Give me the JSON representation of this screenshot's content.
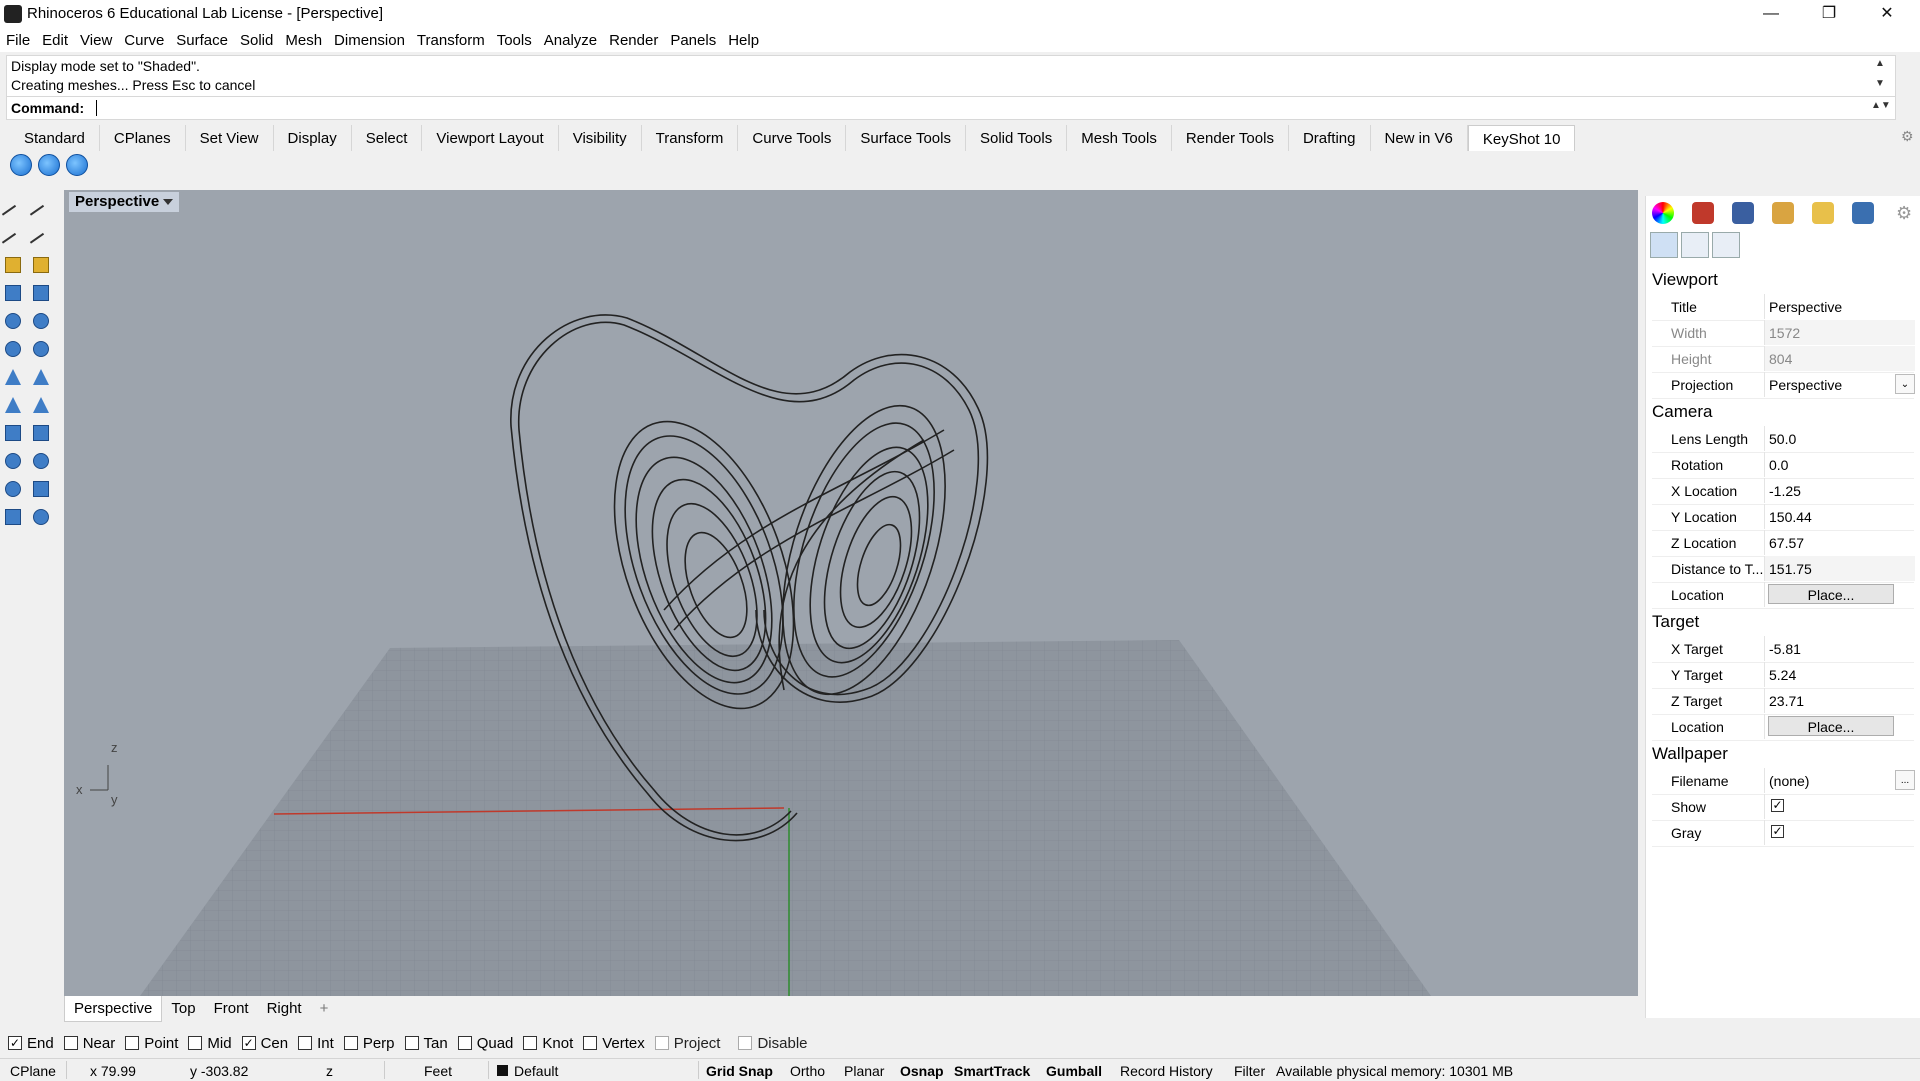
{
  "window": {
    "title": "Rhinoceros 6 Educational Lab License - [Perspective]"
  },
  "menu": [
    "File",
    "Edit",
    "View",
    "Curve",
    "Surface",
    "Solid",
    "Mesh",
    "Dimension",
    "Transform",
    "Tools",
    "Analyze",
    "Render",
    "Panels",
    "Help"
  ],
  "command": {
    "history": [
      "Display mode set to \"Shaded\".",
      "Creating meshes... Press Esc to cancel"
    ],
    "prompt_label": "Command:"
  },
  "toolbar_tabs": [
    "Standard",
    "CPlanes",
    "Set View",
    "Display",
    "Select",
    "Viewport Layout",
    "Visibility",
    "Transform",
    "Curve Tools",
    "Surface Tools",
    "Solid Tools",
    "Mesh Tools",
    "Render Tools",
    "Drafting",
    "New in V6",
    "KeyShot 10"
  ],
  "toolbar_tabs_active": "KeyShot 10",
  "keyshot_icons": [
    "keyshot-render-icon",
    "keyshot-update-icon",
    "keyshot-link-icon"
  ],
  "viewport": {
    "title": "Perspective",
    "axis_labels": {
      "z": "z",
      "x": "x",
      "y": "y"
    }
  },
  "viewport_tabs": [
    "Perspective",
    "Top",
    "Front",
    "Right"
  ],
  "viewport_tabs_add": "+",
  "panel": {
    "sections": {
      "viewport": "Viewport",
      "camera": "Camera",
      "target": "Target",
      "wallpaper": "Wallpaper"
    },
    "viewport_props": [
      {
        "label": "Title",
        "value": "Perspective"
      },
      {
        "label": "Width",
        "value": "1572"
      },
      {
        "label": "Height",
        "value": "804"
      },
      {
        "label": "Projection",
        "value": "Perspective"
      }
    ],
    "camera_props": [
      {
        "label": "Lens Length",
        "value": "50.0"
      },
      {
        "label": "Rotation",
        "value": "0.0"
      },
      {
        "label": "X Location",
        "value": "-1.25"
      },
      {
        "label": "Y Location",
        "value": "150.44"
      },
      {
        "label": "Z Location",
        "value": "67.57"
      },
      {
        "label": "Distance to T...",
        "value": "151.75"
      },
      {
        "label": "Location",
        "value": "Place..."
      }
    ],
    "target_props": [
      {
        "label": "X Target",
        "value": "-5.81"
      },
      {
        "label": "Y Target",
        "value": "5.24"
      },
      {
        "label": "Z Target",
        "value": "23.71"
      },
      {
        "label": "Location",
        "value": "Place..."
      }
    ],
    "wallpaper_props": [
      {
        "label": "Filename",
        "value": "(none)",
        "button": "..."
      },
      {
        "label": "Show",
        "checked": true
      },
      {
        "label": "Gray",
        "checked": true
      }
    ]
  },
  "osnaps": [
    {
      "label": "End",
      "checked": true
    },
    {
      "label": "Near",
      "checked": false
    },
    {
      "label": "Point",
      "checked": false
    },
    {
      "label": "Mid",
      "checked": false
    },
    {
      "label": "Cen",
      "checked": true
    },
    {
      "label": "Int",
      "checked": false
    },
    {
      "label": "Perp",
      "checked": false
    },
    {
      "label": "Tan",
      "checked": false
    },
    {
      "label": "Quad",
      "checked": false
    },
    {
      "label": "Knot",
      "checked": false
    },
    {
      "label": "Vertex",
      "checked": false
    },
    {
      "label": "Project",
      "checked": false,
      "disabled": true
    },
    {
      "label": "Disable",
      "checked": false,
      "disabled": true
    }
  ],
  "status": {
    "cplane": "CPlane",
    "x": "x 79.99",
    "y": "y -303.82",
    "z": "z",
    "units": "Feet",
    "layer": "Default",
    "grid_snap": "Grid Snap",
    "ortho": "Ortho",
    "planar": "Planar",
    "osnap": "Osnap",
    "smarttrack": "SmartTrack",
    "gumball": "Gumball",
    "record_history": "Record History",
    "filter": "Filter",
    "memory": "Available physical memory: 10301 MB"
  },
  "colors": {
    "viewport_bg": "#9da4ad",
    "x_axis": "#c0392b",
    "y_axis": "#2e8b2e"
  }
}
